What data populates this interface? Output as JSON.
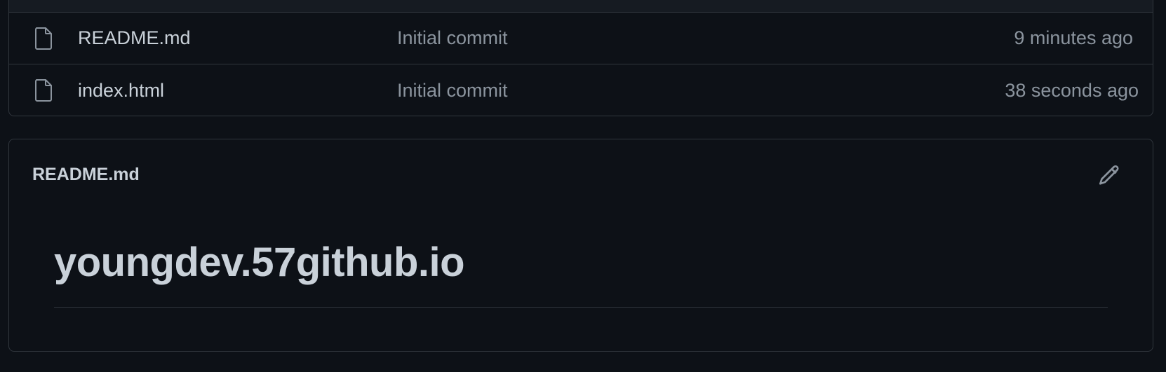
{
  "files": [
    {
      "icon": "file-icon",
      "name": "README.md",
      "commit_message": "Initial commit",
      "time": "9 minutes ago"
    },
    {
      "icon": "file-icon",
      "name": "index.html",
      "commit_message": "Initial commit",
      "time": "38 seconds ago"
    }
  ],
  "readme": {
    "header": "README.md",
    "edit_icon": "pencil-icon",
    "title": "youngdev.57github.io"
  },
  "colors": {
    "background": "#0d1117",
    "border": "#30363d",
    "text_primary": "#c9d1d9",
    "text_muted": "#8b949e",
    "header_strip": "#161b22"
  }
}
